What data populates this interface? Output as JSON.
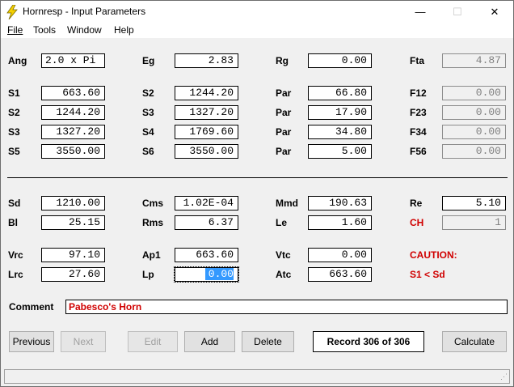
{
  "window": {
    "title": "Hornresp - Input Parameters",
    "minimize": "—",
    "maximize": "☐",
    "close": "✕"
  },
  "menu": {
    "file": "File",
    "tools": "Tools",
    "window": "Window",
    "help": "Help"
  },
  "params": {
    "ang": {
      "label": "Ang",
      "value": "2.0 x Pi"
    },
    "eg": {
      "label": "Eg",
      "value": "2.83"
    },
    "rg": {
      "label": "Rg",
      "value": "0.00"
    },
    "fta": {
      "label": "Fta",
      "value": "4.87"
    },
    "s1": {
      "label": "S1",
      "value": "663.60"
    },
    "s2": {
      "label": "S2",
      "value": "1244.20"
    },
    "par1": {
      "label": "Par",
      "value": "66.80"
    },
    "f12": {
      "label": "F12",
      "value": "0.00"
    },
    "s2b": {
      "label": "S2",
      "value": "1244.20"
    },
    "s3": {
      "label": "S3",
      "value": "1327.20"
    },
    "par2": {
      "label": "Par",
      "value": "17.90"
    },
    "f23": {
      "label": "F23",
      "value": "0.00"
    },
    "s3b": {
      "label": "S3",
      "value": "1327.20"
    },
    "s4": {
      "label": "S4",
      "value": "1769.60"
    },
    "par3": {
      "label": "Par",
      "value": "34.80"
    },
    "f34": {
      "label": "F34",
      "value": "0.00"
    },
    "s5": {
      "label": "S5",
      "value": "3550.00"
    },
    "s6": {
      "label": "S6",
      "value": "3550.00"
    },
    "par4": {
      "label": "Par",
      "value": "5.00"
    },
    "f56": {
      "label": "F56",
      "value": "0.00"
    },
    "sd": {
      "label": "Sd",
      "value": "1210.00"
    },
    "cms": {
      "label": "Cms",
      "value": "1.02E-04"
    },
    "mmd": {
      "label": "Mmd",
      "value": "190.63"
    },
    "re": {
      "label": "Re",
      "value": "5.10"
    },
    "bl": {
      "label": "Bl",
      "value": "25.15"
    },
    "rms": {
      "label": "Rms",
      "value": "6.37"
    },
    "le": {
      "label": "Le",
      "value": "1.60"
    },
    "ch": {
      "label": "CH",
      "value": "1"
    },
    "vrc": {
      "label": "Vrc",
      "value": "97.10"
    },
    "ap1": {
      "label": "Ap1",
      "value": "663.60"
    },
    "vtc": {
      "label": "Vtc",
      "value": "0.00"
    },
    "lrc": {
      "label": "Lrc",
      "value": "27.60"
    },
    "lp": {
      "label": "Lp",
      "value": "0.00"
    },
    "atc": {
      "label": "Atc",
      "value": "663.60"
    }
  },
  "caution": {
    "title": "CAUTION:",
    "message": "S1 < Sd"
  },
  "comment": {
    "label": "Comment",
    "value": "Pabesco's Horn"
  },
  "buttons": {
    "previous": "Previous",
    "next": "Next",
    "edit": "Edit",
    "add": "Add",
    "delete": "Delete",
    "record": "Record 306 of 306",
    "calculate": "Calculate"
  },
  "colors": {
    "warning": "#d00000",
    "selection": "#3399ff",
    "app_icon": "#f5d000"
  }
}
